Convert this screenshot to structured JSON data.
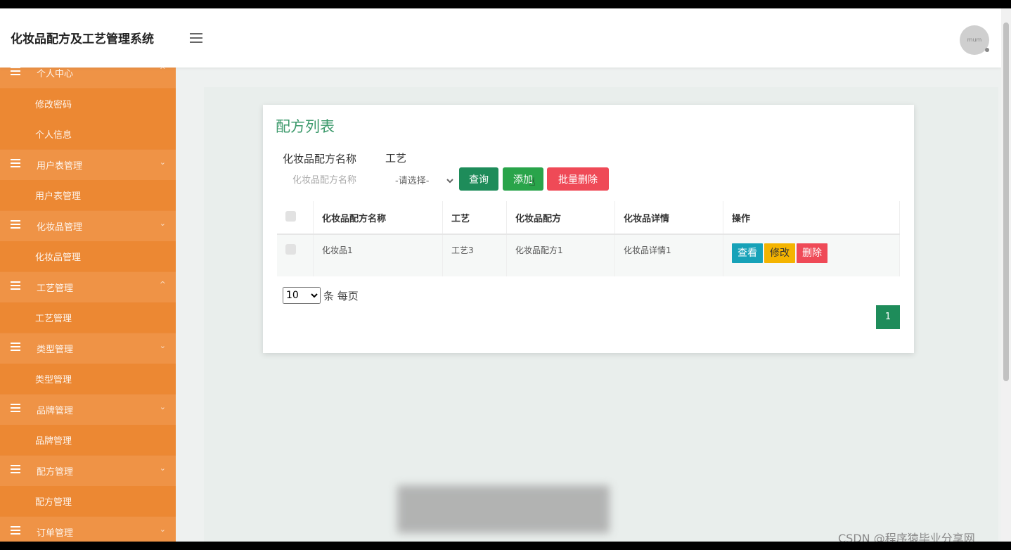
{
  "header": {
    "app_title": "化妆品配方及工艺管理系统",
    "avatar_text": "mum"
  },
  "sidebar": {
    "rows": [
      {
        "label": "个人中心",
        "type": "group",
        "arrow": "^"
      },
      {
        "label": "修改密码",
        "type": "sub"
      },
      {
        "label": "个人信息",
        "type": "sub"
      },
      {
        "label": "用户表管理",
        "type": "group",
        "arrow": "⌄"
      },
      {
        "label": "用户表管理",
        "type": "sub"
      },
      {
        "label": "化妆品管理",
        "type": "group",
        "arrow": "⌄"
      },
      {
        "label": "化妆品管理",
        "type": "sub"
      },
      {
        "label": "工艺管理",
        "type": "group",
        "arrow": "^"
      },
      {
        "label": "工艺管理",
        "type": "sub"
      },
      {
        "label": "类型管理",
        "type": "group",
        "arrow": "⌄"
      },
      {
        "label": "类型管理",
        "type": "sub"
      },
      {
        "label": "品牌管理",
        "type": "group",
        "arrow": "⌄"
      },
      {
        "label": "品牌管理",
        "type": "sub"
      },
      {
        "label": "配方管理",
        "type": "group",
        "arrow": "⌄"
      },
      {
        "label": "配方管理",
        "type": "sub"
      },
      {
        "label": "订单管理",
        "type": "group",
        "arrow": "⌄"
      }
    ]
  },
  "card": {
    "title": "配方列表",
    "filter_name_label": "化妆品配方名称",
    "filter_name_placeholder": "化妆品配方名称",
    "filter_process_label": "工艺",
    "filter_process_selected": "-请选择-",
    "btn_query": "查询",
    "btn_add": "添加",
    "btn_batch_delete": "批量删除"
  },
  "table": {
    "headers": [
      "化妆品配方名称",
      "工艺",
      "化妆品配方",
      "化妆品详情",
      "操作"
    ],
    "rows": [
      {
        "name": "化妆品1",
        "process": "工艺3",
        "formula": "化妆品配方1",
        "detail": "化妆品详情1"
      }
    ],
    "actions": {
      "view": "查看",
      "edit": "修改",
      "delete": "删除"
    }
  },
  "pager": {
    "page_size": "10",
    "per_page_label": "条 每页",
    "current_page": "1"
  },
  "watermark": "CSDN @程序猿毕业分享网",
  "colors": {
    "sidebar": "#ec8b3a",
    "accent_green": "#1e8c5a",
    "danger": "#ef4a57",
    "warning": "#f4b400",
    "info": "#17a2b8"
  }
}
